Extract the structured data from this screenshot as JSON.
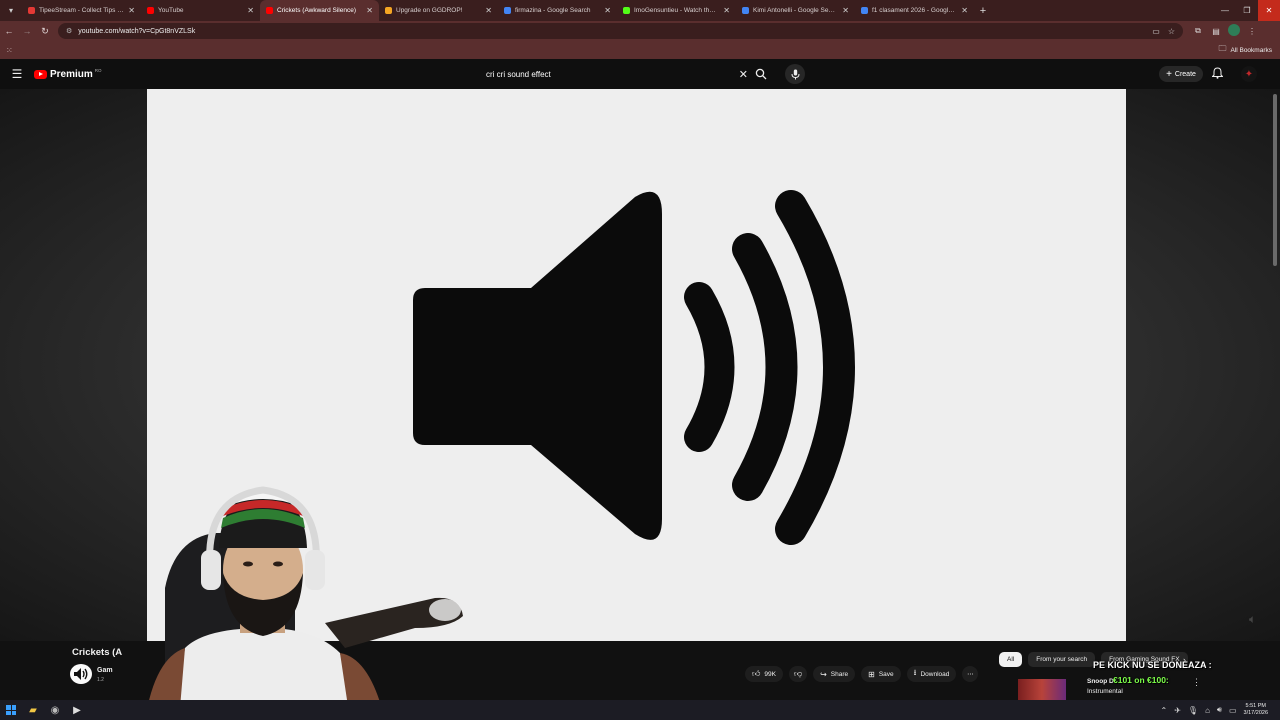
{
  "browser": {
    "tabs": [
      {
        "title": "TipeeStream - Collect Tips wh",
        "favicon_color": "#e53935",
        "active": false
      },
      {
        "title": "YouTube",
        "favicon_color": "#ff0000",
        "active": false
      },
      {
        "title": "Crickets (Awkward Silence)",
        "favicon_color": "#ff0000",
        "active": true
      },
      {
        "title": "Upgrade on GGDROP!",
        "favicon_color": "#f5a623",
        "active": false
      },
      {
        "title": "firmazina - Google Search",
        "favicon_color": "#4285f4",
        "active": false
      },
      {
        "title": "ImoGensuntieu - Watch the VOD",
        "favicon_color": "#53fc18",
        "active": false
      },
      {
        "title": "Kimi Antonelli - Google Search",
        "favicon_color": "#4285f4",
        "active": false
      },
      {
        "title": "f1 clasament 2026 - Google Se",
        "favicon_color": "#4285f4",
        "active": false
      }
    ],
    "url": "youtube.com/watch?v=CpGt8nVZLSk",
    "bookmarks_label": "All Bookmarks"
  },
  "youtube": {
    "logo_text": "Premium",
    "logo_sup": "RO",
    "search_query": "cri cri sound effect",
    "create_label": "Create",
    "video": {
      "title": "Crickets (A",
      "channel_name": "Gam",
      "subscribers": "1.2",
      "like_count": "99K",
      "share_label": "Share",
      "save_label": "Save",
      "download_label": "Download"
    },
    "chips": [
      {
        "label": "All",
        "active": true
      },
      {
        "label": "From your search",
        "active": false
      },
      {
        "label": "From Gaming Sound FX",
        "active": false
      }
    ],
    "recommendation": {
      "title": "Snoop D",
      "subtitle": "Instrumental"
    }
  },
  "overlay": {
    "line1": "PE KICK NU SE DONEAZA :",
    "line2": "€101 on €100:"
  },
  "taskbar": {
    "time": "5:51 PM",
    "date": "3/17/2026"
  },
  "colors": {
    "chrome_dark": "#3a1e1e",
    "chrome_light": "#5a2e2e",
    "youtube_red": "#ff0000",
    "player_bg": "#eeeeee"
  }
}
